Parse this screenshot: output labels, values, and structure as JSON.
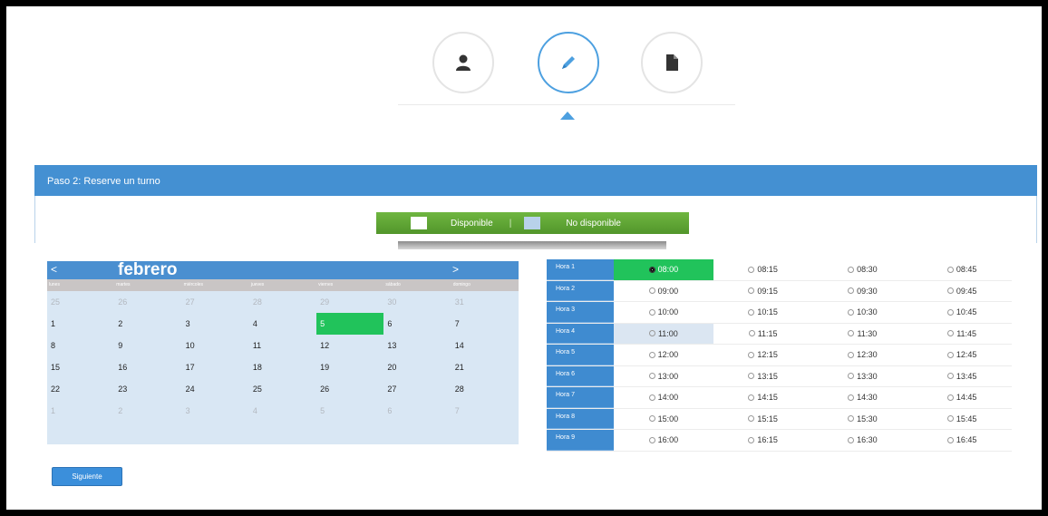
{
  "steps": [
    {
      "icon": "user-icon",
      "active": false
    },
    {
      "icon": "pencil-icon",
      "active": true
    },
    {
      "icon": "document-icon",
      "active": false
    }
  ],
  "panel": {
    "title": "Paso 2: Reserve un turno"
  },
  "legend": {
    "available": "Disponible",
    "separator": "|",
    "unavailable": "No disponible",
    "available_color": "#ffffff",
    "unavailable_color": "#b8d2ea"
  },
  "calendar": {
    "prev": "<",
    "next": ">",
    "month": "febrero",
    "weekdays": [
      "lunes",
      "martes",
      "miércoles",
      "jueves",
      "viernes",
      "sábado",
      "domingo"
    ],
    "weeks": [
      [
        {
          "d": "25",
          "m": true
        },
        {
          "d": "26",
          "m": true
        },
        {
          "d": "27",
          "m": true
        },
        {
          "d": "28",
          "m": true
        },
        {
          "d": "29",
          "m": true
        },
        {
          "d": "30",
          "m": true
        },
        {
          "d": "31",
          "m": true
        }
      ],
      [
        {
          "d": "1"
        },
        {
          "d": "2"
        },
        {
          "d": "3"
        },
        {
          "d": "4"
        },
        {
          "d": "5",
          "s": true
        },
        {
          "d": "6"
        },
        {
          "d": "7"
        }
      ],
      [
        {
          "d": "8"
        },
        {
          "d": "9"
        },
        {
          "d": "10"
        },
        {
          "d": "11"
        },
        {
          "d": "12"
        },
        {
          "d": "13"
        },
        {
          "d": "14"
        }
      ],
      [
        {
          "d": "15"
        },
        {
          "d": "16"
        },
        {
          "d": "17"
        },
        {
          "d": "18"
        },
        {
          "d": "19"
        },
        {
          "d": "20"
        },
        {
          "d": "21"
        }
      ],
      [
        {
          "d": "22"
        },
        {
          "d": "23"
        },
        {
          "d": "24"
        },
        {
          "d": "25"
        },
        {
          "d": "26"
        },
        {
          "d": "27"
        },
        {
          "d": "28"
        }
      ],
      [
        {
          "d": "1",
          "m": true
        },
        {
          "d": "2",
          "m": true
        },
        {
          "d": "3",
          "m": true
        },
        {
          "d": "4",
          "m": true
        },
        {
          "d": "5",
          "m": true
        },
        {
          "d": "6",
          "m": true
        },
        {
          "d": "7",
          "m": true
        }
      ]
    ],
    "selected_color": "#21c35b"
  },
  "slots": {
    "rows": [
      {
        "label": "Hora 1",
        "times": [
          "08:00",
          "08:15",
          "08:30",
          "08:45"
        ],
        "selected": 0
      },
      {
        "label": "Hora 2",
        "times": [
          "09:00",
          "09:15",
          "09:30",
          "09:45"
        ]
      },
      {
        "label": "Hora 3",
        "times": [
          "10:00",
          "10:15",
          "10:30",
          "10:45"
        ]
      },
      {
        "label": "Hora 4",
        "times": [
          "11:00",
          "11:15",
          "11:30",
          "11:45"
        ],
        "highlight": 0
      },
      {
        "label": "Hora 5",
        "times": [
          "12:00",
          "12:15",
          "12:30",
          "12:45"
        ]
      },
      {
        "label": "Hora 6",
        "times": [
          "13:00",
          "13:15",
          "13:30",
          "13:45"
        ]
      },
      {
        "label": "Hora 7",
        "times": [
          "14:00",
          "14:15",
          "14:30",
          "14:45"
        ]
      },
      {
        "label": "Hora 8",
        "times": [
          "15:00",
          "15:15",
          "15:30",
          "15:45"
        ]
      },
      {
        "label": "Hora 9",
        "times": [
          "16:00",
          "16:15",
          "16:30",
          "16:45"
        ]
      }
    ]
  },
  "next_button": "Siguiente"
}
